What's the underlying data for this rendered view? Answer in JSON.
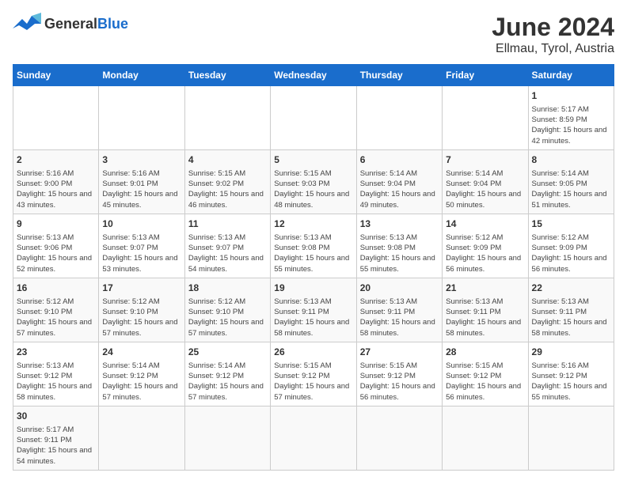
{
  "title": "June 2024",
  "subtitle": "Ellmau, Tyrol, Austria",
  "logo": {
    "text_general": "General",
    "text_blue": "Blue"
  },
  "days_of_week": [
    "Sunday",
    "Monday",
    "Tuesday",
    "Wednesday",
    "Thursday",
    "Friday",
    "Saturday"
  ],
  "weeks": [
    [
      {
        "day": "",
        "info": ""
      },
      {
        "day": "",
        "info": ""
      },
      {
        "day": "",
        "info": ""
      },
      {
        "day": "",
        "info": ""
      },
      {
        "day": "",
        "info": ""
      },
      {
        "day": "",
        "info": ""
      },
      {
        "day": "1",
        "info": "Sunrise: 5:17 AM\nSunset: 8:59 PM\nDaylight: 15 hours and 42 minutes."
      }
    ],
    [
      {
        "day": "2",
        "info": "Sunrise: 5:16 AM\nSunset: 9:00 PM\nDaylight: 15 hours and 43 minutes."
      },
      {
        "day": "3",
        "info": "Sunrise: 5:16 AM\nSunset: 9:01 PM\nDaylight: 15 hours and 45 minutes."
      },
      {
        "day": "4",
        "info": "Sunrise: 5:15 AM\nSunset: 9:02 PM\nDaylight: 15 hours and 46 minutes."
      },
      {
        "day": "5",
        "info": "Sunrise: 5:15 AM\nSunset: 9:03 PM\nDaylight: 15 hours and 48 minutes."
      },
      {
        "day": "6",
        "info": "Sunrise: 5:14 AM\nSunset: 9:04 PM\nDaylight: 15 hours and 49 minutes."
      },
      {
        "day": "7",
        "info": "Sunrise: 5:14 AM\nSunset: 9:04 PM\nDaylight: 15 hours and 50 minutes."
      },
      {
        "day": "8",
        "info": "Sunrise: 5:14 AM\nSunset: 9:05 PM\nDaylight: 15 hours and 51 minutes."
      }
    ],
    [
      {
        "day": "9",
        "info": "Sunrise: 5:13 AM\nSunset: 9:06 PM\nDaylight: 15 hours and 52 minutes."
      },
      {
        "day": "10",
        "info": "Sunrise: 5:13 AM\nSunset: 9:07 PM\nDaylight: 15 hours and 53 minutes."
      },
      {
        "day": "11",
        "info": "Sunrise: 5:13 AM\nSunset: 9:07 PM\nDaylight: 15 hours and 54 minutes."
      },
      {
        "day": "12",
        "info": "Sunrise: 5:13 AM\nSunset: 9:08 PM\nDaylight: 15 hours and 55 minutes."
      },
      {
        "day": "13",
        "info": "Sunrise: 5:13 AM\nSunset: 9:08 PM\nDaylight: 15 hours and 55 minutes."
      },
      {
        "day": "14",
        "info": "Sunrise: 5:12 AM\nSunset: 9:09 PM\nDaylight: 15 hours and 56 minutes."
      },
      {
        "day": "15",
        "info": "Sunrise: 5:12 AM\nSunset: 9:09 PM\nDaylight: 15 hours and 56 minutes."
      }
    ],
    [
      {
        "day": "16",
        "info": "Sunrise: 5:12 AM\nSunset: 9:10 PM\nDaylight: 15 hours and 57 minutes."
      },
      {
        "day": "17",
        "info": "Sunrise: 5:12 AM\nSunset: 9:10 PM\nDaylight: 15 hours and 57 minutes."
      },
      {
        "day": "18",
        "info": "Sunrise: 5:12 AM\nSunset: 9:10 PM\nDaylight: 15 hours and 57 minutes."
      },
      {
        "day": "19",
        "info": "Sunrise: 5:13 AM\nSunset: 9:11 PM\nDaylight: 15 hours and 58 minutes."
      },
      {
        "day": "20",
        "info": "Sunrise: 5:13 AM\nSunset: 9:11 PM\nDaylight: 15 hours and 58 minutes."
      },
      {
        "day": "21",
        "info": "Sunrise: 5:13 AM\nSunset: 9:11 PM\nDaylight: 15 hours and 58 minutes."
      },
      {
        "day": "22",
        "info": "Sunrise: 5:13 AM\nSunset: 9:11 PM\nDaylight: 15 hours and 58 minutes."
      }
    ],
    [
      {
        "day": "23",
        "info": "Sunrise: 5:13 AM\nSunset: 9:12 PM\nDaylight: 15 hours and 58 minutes."
      },
      {
        "day": "24",
        "info": "Sunrise: 5:14 AM\nSunset: 9:12 PM\nDaylight: 15 hours and 57 minutes."
      },
      {
        "day": "25",
        "info": "Sunrise: 5:14 AM\nSunset: 9:12 PM\nDaylight: 15 hours and 57 minutes."
      },
      {
        "day": "26",
        "info": "Sunrise: 5:15 AM\nSunset: 9:12 PM\nDaylight: 15 hours and 57 minutes."
      },
      {
        "day": "27",
        "info": "Sunrise: 5:15 AM\nSunset: 9:12 PM\nDaylight: 15 hours and 56 minutes."
      },
      {
        "day": "28",
        "info": "Sunrise: 5:15 AM\nSunset: 9:12 PM\nDaylight: 15 hours and 56 minutes."
      },
      {
        "day": "29",
        "info": "Sunrise: 5:16 AM\nSunset: 9:12 PM\nDaylight: 15 hours and 55 minutes."
      }
    ],
    [
      {
        "day": "30",
        "info": "Sunrise: 5:17 AM\nSunset: 9:11 PM\nDaylight: 15 hours and 54 minutes."
      },
      {
        "day": "",
        "info": ""
      },
      {
        "day": "",
        "info": ""
      },
      {
        "day": "",
        "info": ""
      },
      {
        "day": "",
        "info": ""
      },
      {
        "day": "",
        "info": ""
      },
      {
        "day": "",
        "info": ""
      }
    ]
  ]
}
